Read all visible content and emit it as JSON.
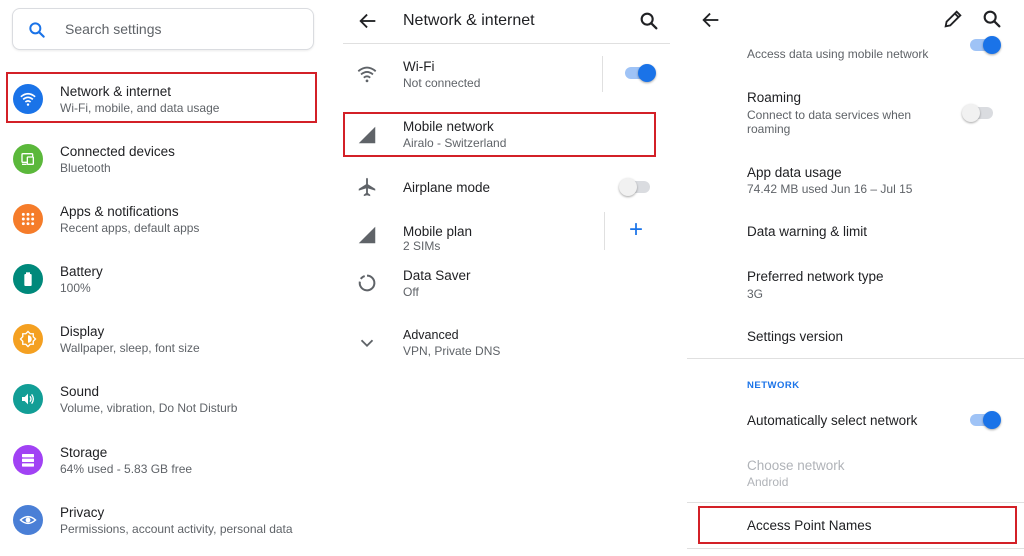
{
  "settings_panel": {
    "search_placeholder": "Search settings",
    "items": [
      {
        "title": "Network & internet",
        "subtitle": "Wi-Fi, mobile, and data usage",
        "icon": "wifi-icon",
        "color": "#1a73e8"
      },
      {
        "title": "Connected devices",
        "subtitle": "Bluetooth",
        "icon": "connected-devices-icon",
        "color": "#5bb83b"
      },
      {
        "title": "Apps & notifications",
        "subtitle": "Recent apps, default apps",
        "icon": "apps-grid-icon",
        "color": "#f57c2a"
      },
      {
        "title": "Battery",
        "subtitle": "100%",
        "icon": "battery-icon",
        "color": "#00897b"
      },
      {
        "title": "Display",
        "subtitle": "Wallpaper, sleep, font size",
        "icon": "display-brightness-icon",
        "color": "#f4a021"
      },
      {
        "title": "Sound",
        "subtitle": "Volume, vibration, Do Not Disturb",
        "icon": "sound-icon",
        "color": "#129e96"
      },
      {
        "title": "Storage",
        "subtitle": "64% used - 5.83 GB free",
        "icon": "storage-icon",
        "color": "#a142f4"
      },
      {
        "title": "Privacy",
        "subtitle": "Permissions, account activity, personal data",
        "icon": "privacy-eye-icon",
        "color": "#4a7fd6"
      }
    ]
  },
  "network_panel": {
    "title": "Network & internet",
    "items": [
      {
        "title": "Wi-Fi",
        "subtitle": "Not connected",
        "toggle": "on"
      },
      {
        "title": "Mobile network",
        "subtitle": "Airalo - Switzerland"
      },
      {
        "title": "Airplane mode",
        "subtitle": "",
        "toggle": "off"
      },
      {
        "title": "Mobile plan",
        "subtitle": "2 SIMs",
        "action": "+"
      },
      {
        "title": "Data Saver",
        "subtitle": "Off"
      },
      {
        "title": "Advanced",
        "subtitle": "VPN, Private DNS"
      }
    ]
  },
  "mobile_panel": {
    "items": [
      {
        "title": "",
        "subtitle": "Access data using mobile network",
        "toggle": "on"
      },
      {
        "title": "Roaming",
        "subtitle": "Connect to data services when roaming",
        "toggle": "off"
      },
      {
        "title": "App data usage",
        "subtitle": "74.42 MB used Jun 16 – Jul 15"
      },
      {
        "title": "Data warning & limit",
        "subtitle": ""
      },
      {
        "title": "Preferred network type",
        "subtitle": "3G"
      },
      {
        "title": "Settings version",
        "subtitle": ""
      }
    ],
    "section_header": "NETWORK",
    "network_items": [
      {
        "title": "Automatically select network",
        "toggle": "on"
      },
      {
        "title": "Choose network",
        "subtitle": "Android",
        "disabled": true
      },
      {
        "title": "Access Point Names"
      }
    ]
  },
  "colors": {
    "accent": "#1a73e8",
    "highlight": "#d32027"
  }
}
